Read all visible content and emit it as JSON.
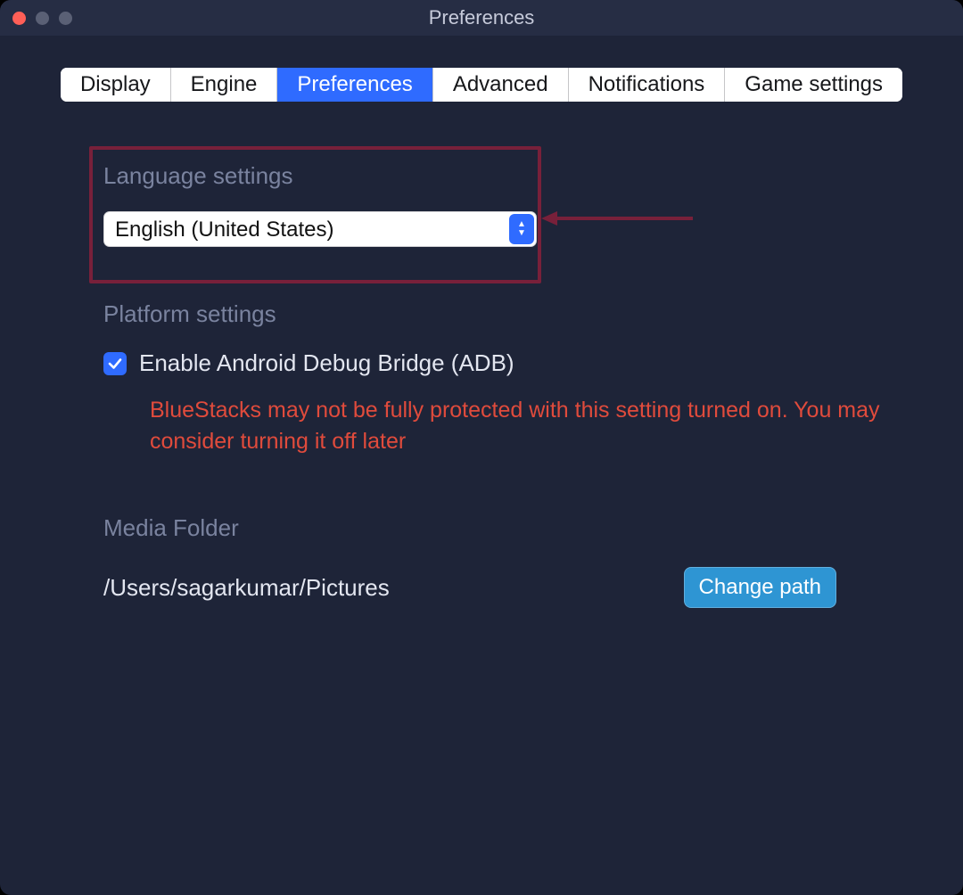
{
  "window": {
    "title": "Preferences"
  },
  "tabs": {
    "display": "Display",
    "engine": "Engine",
    "preferences": "Preferences",
    "advanced": "Advanced",
    "notifications": "Notifications",
    "game_settings": "Game settings",
    "active": "preferences"
  },
  "language": {
    "section_title": "Language settings",
    "selected": "English (United States)"
  },
  "platform": {
    "section_title": "Platform settings",
    "adb_label": "Enable Android Debug Bridge (ADB)",
    "adb_checked": true,
    "warning": "BlueStacks may not be fully protected with this setting turned on. You may consider turning it off later"
  },
  "media": {
    "section_title": "Media Folder",
    "path": "/Users/sagarkumar/Pictures",
    "change_button": "Change path"
  },
  "colors": {
    "accent": "#2f6bff",
    "warning": "#e04b3c",
    "callout_border": "#78203a"
  }
}
